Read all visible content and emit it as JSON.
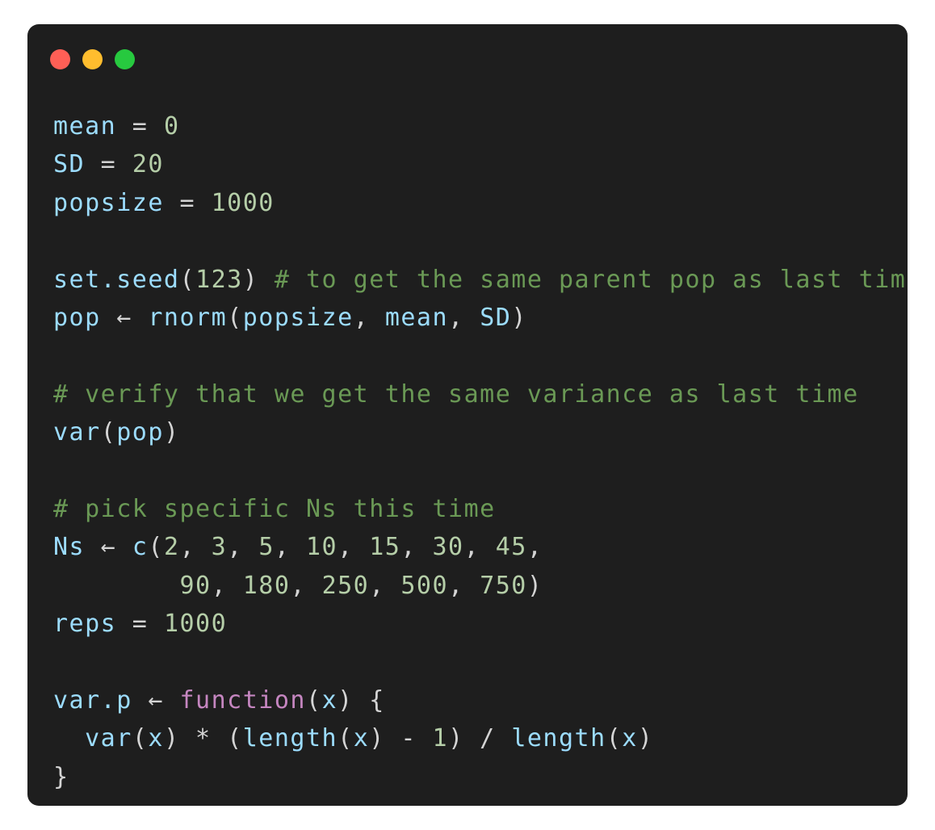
{
  "window": {
    "colors": {
      "background": "#1e1e1e",
      "close": "#ff5f56",
      "minimize": "#ffbd2e",
      "maximize": "#27c93f"
    }
  },
  "code": {
    "language": "R",
    "lines": [
      [
        {
          "t": "mean",
          "c": "var"
        },
        {
          "t": " = ",
          "c": "op"
        },
        {
          "t": "0",
          "c": "num"
        }
      ],
      [
        {
          "t": "SD",
          "c": "var"
        },
        {
          "t": " = ",
          "c": "op"
        },
        {
          "t": "20",
          "c": "num"
        }
      ],
      [
        {
          "t": "popsize",
          "c": "var"
        },
        {
          "t": " = ",
          "c": "op"
        },
        {
          "t": "1000",
          "c": "num"
        }
      ],
      [],
      [
        {
          "t": "set.seed",
          "c": "fn"
        },
        {
          "t": "(",
          "c": "op"
        },
        {
          "t": "123",
          "c": "num"
        },
        {
          "t": ") ",
          "c": "op"
        },
        {
          "t": "# to get the same parent pop as last time",
          "c": "cmt"
        }
      ],
      [
        {
          "t": "pop",
          "c": "var"
        },
        {
          "t": " ← ",
          "c": "op"
        },
        {
          "t": "rnorm",
          "c": "fn"
        },
        {
          "t": "(",
          "c": "op"
        },
        {
          "t": "popsize",
          "c": "var"
        },
        {
          "t": ", ",
          "c": "op"
        },
        {
          "t": "mean",
          "c": "var"
        },
        {
          "t": ", ",
          "c": "op"
        },
        {
          "t": "SD",
          "c": "var"
        },
        {
          "t": ")",
          "c": "op"
        }
      ],
      [],
      [
        {
          "t": "# verify that we get the same variance as last time",
          "c": "cmt"
        }
      ],
      [
        {
          "t": "var",
          "c": "fn"
        },
        {
          "t": "(",
          "c": "op"
        },
        {
          "t": "pop",
          "c": "var"
        },
        {
          "t": ")",
          "c": "op"
        }
      ],
      [],
      [
        {
          "t": "# pick specific Ns this time",
          "c": "cmt"
        }
      ],
      [
        {
          "t": "Ns",
          "c": "var"
        },
        {
          "t": " ← ",
          "c": "op"
        },
        {
          "t": "c",
          "c": "fn"
        },
        {
          "t": "(",
          "c": "op"
        },
        {
          "t": "2",
          "c": "num"
        },
        {
          "t": ", ",
          "c": "op"
        },
        {
          "t": "3",
          "c": "num"
        },
        {
          "t": ", ",
          "c": "op"
        },
        {
          "t": "5",
          "c": "num"
        },
        {
          "t": ", ",
          "c": "op"
        },
        {
          "t": "10",
          "c": "num"
        },
        {
          "t": ", ",
          "c": "op"
        },
        {
          "t": "15",
          "c": "num"
        },
        {
          "t": ", ",
          "c": "op"
        },
        {
          "t": "30",
          "c": "num"
        },
        {
          "t": ", ",
          "c": "op"
        },
        {
          "t": "45",
          "c": "num"
        },
        {
          "t": ",",
          "c": "op"
        }
      ],
      [
        {
          "t": "        ",
          "c": "op"
        },
        {
          "t": "90",
          "c": "num"
        },
        {
          "t": ", ",
          "c": "op"
        },
        {
          "t": "180",
          "c": "num"
        },
        {
          "t": ", ",
          "c": "op"
        },
        {
          "t": "250",
          "c": "num"
        },
        {
          "t": ", ",
          "c": "op"
        },
        {
          "t": "500",
          "c": "num"
        },
        {
          "t": ", ",
          "c": "op"
        },
        {
          "t": "750",
          "c": "num"
        },
        {
          "t": ")",
          "c": "op"
        }
      ],
      [
        {
          "t": "reps",
          "c": "var"
        },
        {
          "t": " = ",
          "c": "op"
        },
        {
          "t": "1000",
          "c": "num"
        }
      ],
      [],
      [
        {
          "t": "var.p",
          "c": "var"
        },
        {
          "t": " ← ",
          "c": "op"
        },
        {
          "t": "function",
          "c": "kw"
        },
        {
          "t": "(",
          "c": "op"
        },
        {
          "t": "x",
          "c": "var"
        },
        {
          "t": ") {",
          "c": "op"
        }
      ],
      [
        {
          "t": "  ",
          "c": "op"
        },
        {
          "t": "var",
          "c": "fn"
        },
        {
          "t": "(",
          "c": "op"
        },
        {
          "t": "x",
          "c": "var"
        },
        {
          "t": ") * (",
          "c": "op"
        },
        {
          "t": "length",
          "c": "fn"
        },
        {
          "t": "(",
          "c": "op"
        },
        {
          "t": "x",
          "c": "var"
        },
        {
          "t": ") - ",
          "c": "op"
        },
        {
          "t": "1",
          "c": "num"
        },
        {
          "t": ") / ",
          "c": "op"
        },
        {
          "t": "length",
          "c": "fn"
        },
        {
          "t": "(",
          "c": "op"
        },
        {
          "t": "x",
          "c": "var"
        },
        {
          "t": ")",
          "c": "op"
        }
      ],
      [
        {
          "t": "}",
          "c": "op"
        }
      ]
    ]
  }
}
